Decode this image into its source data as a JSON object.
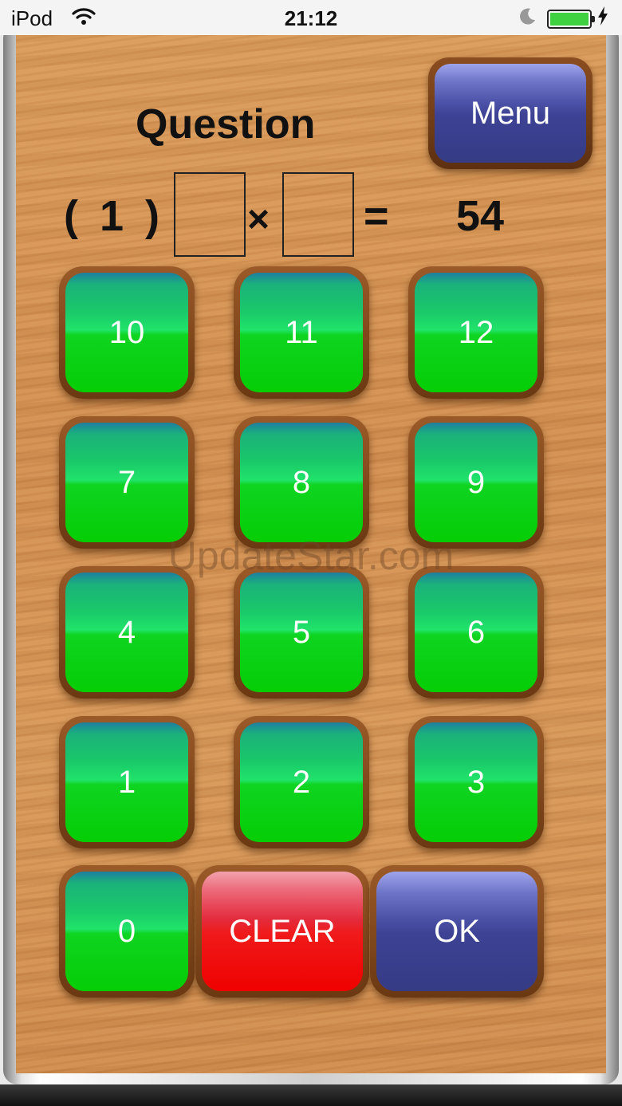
{
  "status_bar": {
    "carrier": "iPod",
    "time": "21:12",
    "wifi_icon": "wifi-icon",
    "battery_icon": "battery-icon"
  },
  "header": {
    "title": "Question",
    "menu_label": "Menu"
  },
  "equation": {
    "index": "( 1 )",
    "operator": "×",
    "equals": "=",
    "result": "54",
    "answer_1": "",
    "answer_2": ""
  },
  "keypad": {
    "k10": "10",
    "k11": "11",
    "k12": "12",
    "k7": "7",
    "k8": "8",
    "k9": "9",
    "k4": "4",
    "k5": "5",
    "k6": "6",
    "k1": "1",
    "k2": "2",
    "k3": "3",
    "k0": "0",
    "clear": "CLEAR",
    "ok": "OK"
  },
  "watermark": "UpdateStar.com",
  "colors": {
    "wood": "#d4914f",
    "key_green": "#05cd05",
    "key_blue": "#3d4294",
    "key_red": "#f01a1a"
  }
}
